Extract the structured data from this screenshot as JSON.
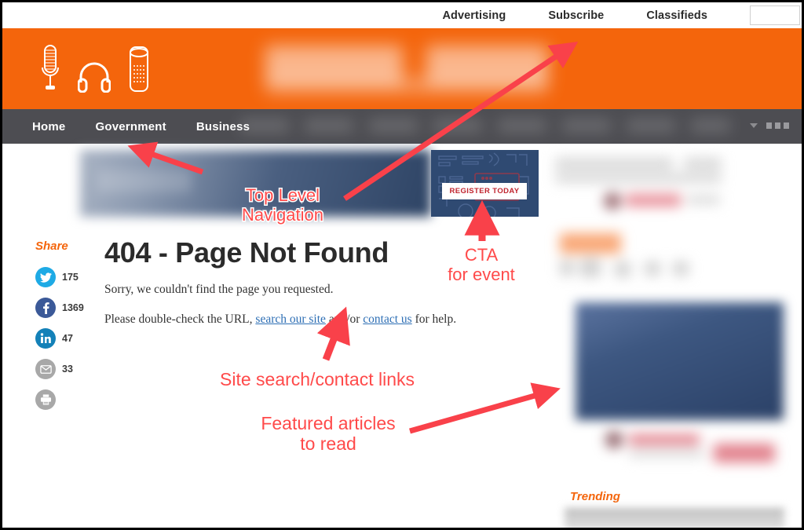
{
  "site": {
    "utility_nav": [
      {
        "label": "Advertising",
        "name": "advertising"
      },
      {
        "label": "Subscribe",
        "name": "subscribe"
      },
      {
        "label": "Classifieds",
        "name": "classifieds"
      }
    ],
    "search": {
      "value": "",
      "placeholder": ""
    },
    "logo_icons": [
      "microphone-icon",
      "headphones-icon",
      "smart-speaker-icon"
    ],
    "main_nav": [
      {
        "label": "Home"
      },
      {
        "label": "Government"
      },
      {
        "label": "Business"
      }
    ],
    "nav_overflow_icon": "more-menu-icon",
    "nav_caret_icon": "chevron-down-icon"
  },
  "cta": {
    "button_label": "REGISTER TODAY"
  },
  "share": {
    "title": "Share",
    "items": [
      {
        "network": "twitter",
        "icon": "twitter-icon",
        "count": "175",
        "color": "#1eaae5"
      },
      {
        "network": "facebook",
        "icon": "facebook-icon",
        "count": "1369",
        "color": "#3b5998"
      },
      {
        "network": "linkedin",
        "icon": "linkedin-icon",
        "count": "47",
        "color": "#1481b8"
      },
      {
        "network": "email",
        "icon": "email-icon",
        "count": "33",
        "color": "#a8a8a8"
      },
      {
        "network": "print",
        "icon": "print-icon",
        "count": "",
        "color": "#a8a8a8"
      }
    ]
  },
  "main": {
    "title": "404 - Page Not Found",
    "paragraph1": "Sorry, we couldn't find the page you requested.",
    "paragraph2_pre": "Please double-check the URL, ",
    "link_search": "search our site",
    "paragraph2_mid": " and/or ",
    "link_contact": "contact us",
    "paragraph2_post": " for help."
  },
  "sidebar": {
    "trending_title": "Trending"
  },
  "annotations": [
    {
      "id": "top-level-nav",
      "line1": "Top Level",
      "line2": "Navigation"
    },
    {
      "id": "cta-for-event",
      "line1": "CTA",
      "line2": "for event"
    },
    {
      "id": "site-search-contact",
      "line1": "Site search/contact links",
      "line2": ""
    },
    {
      "id": "featured-articles",
      "line1": "Featured articles",
      "line2": "to read"
    }
  ],
  "colors": {
    "brand_orange": "#f4650c",
    "nav_dark": "#4d4d52",
    "annotation_red": "#ff4a4a",
    "link_blue": "#2e6fb5",
    "cta_red": "#c0242e",
    "cta_navy": "#2f4a72"
  }
}
